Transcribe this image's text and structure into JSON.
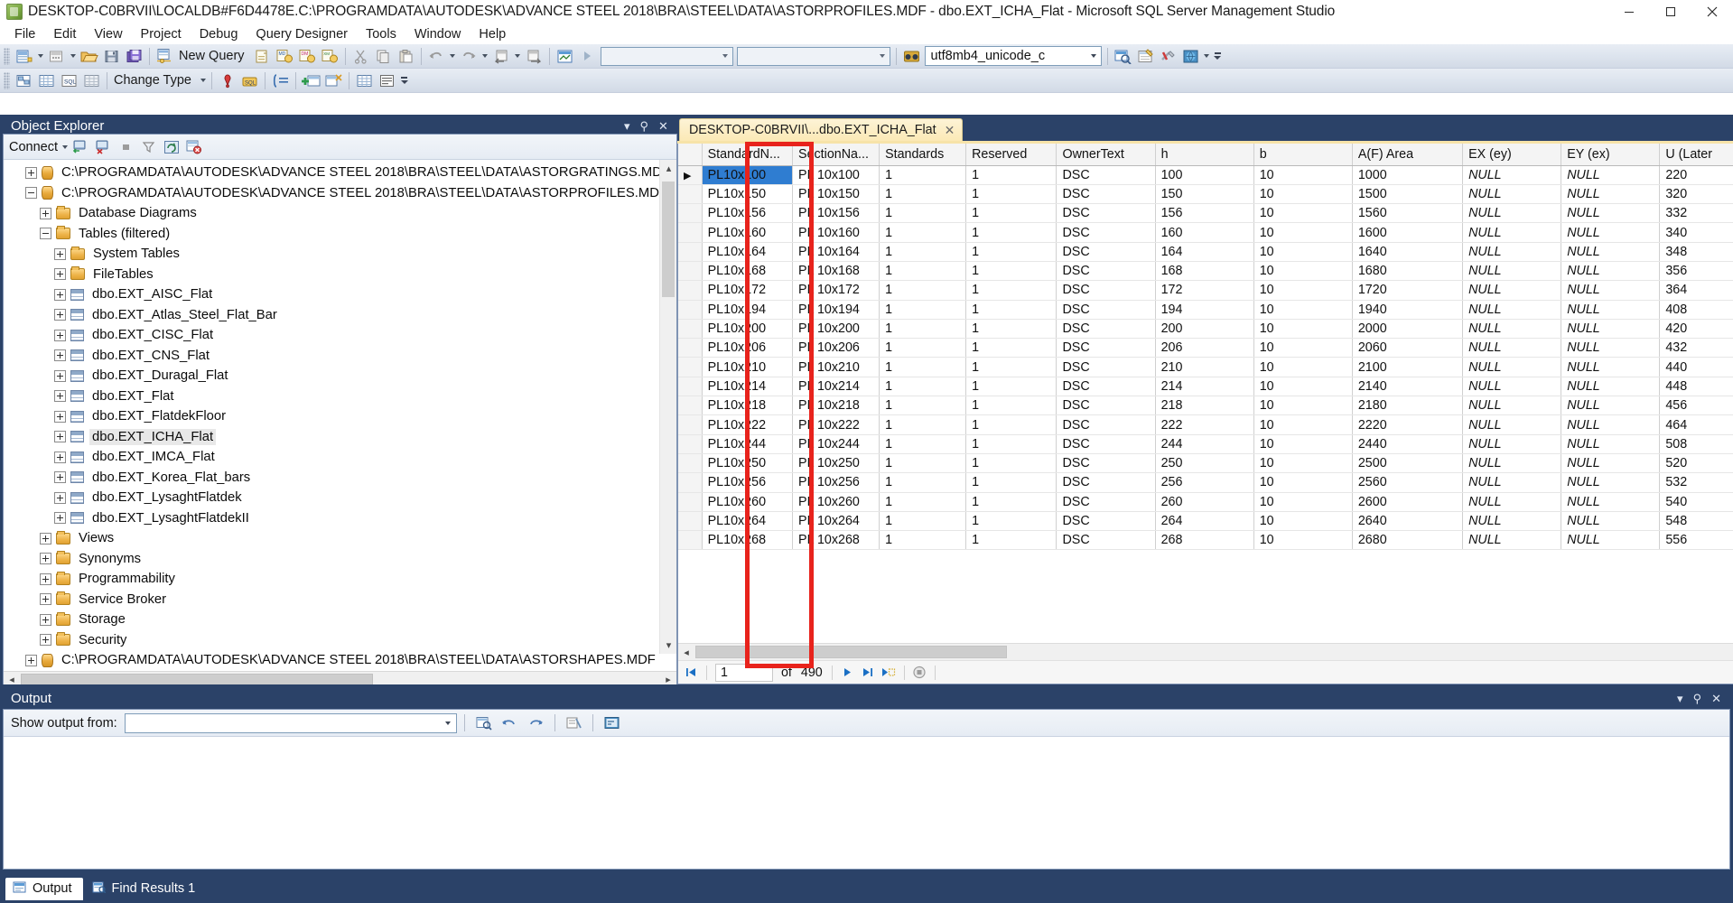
{
  "window": {
    "title": "DESKTOP-C0BRVII\\LOCALDB#F6D4478E.C:\\PROGRAMDATA\\AUTODESK\\ADVANCE STEEL 2018\\BRA\\STEEL\\DATA\\ASTORPROFILES.MDF - dbo.EXT_ICHA_Flat - Microsoft SQL Server Management Studio",
    "app_icon": "ssms-icon",
    "minimize": "minimize-icon",
    "maximize": "maximize-icon",
    "close": "close-icon"
  },
  "menubar": {
    "items": [
      {
        "label": "File"
      },
      {
        "label": "Edit"
      },
      {
        "label": "View"
      },
      {
        "label": "Project"
      },
      {
        "label": "Debug"
      },
      {
        "label": "Query Designer"
      },
      {
        "label": "Tools"
      },
      {
        "label": "Window"
      },
      {
        "label": "Help"
      }
    ]
  },
  "toolbar1": {
    "new_query_label": "New Query",
    "collation_value": "utf8mb4_unicode_c",
    "server_dropdown_value": "",
    "database_dropdown_value": ""
  },
  "toolbar2": {
    "change_type_label": "Change Type"
  },
  "object_explorer": {
    "title": "Object Explorer",
    "connect_label": "Connect",
    "tree": [
      {
        "label": "C:\\PROGRAMDATA\\AUTODESK\\ADVANCE STEEL 2018\\BRA\\STEEL\\DATA\\ASTORGRATINGS.MDF",
        "indent": 1,
        "icon": "database-icon",
        "state": "plus"
      },
      {
        "label": "C:\\PROGRAMDATA\\AUTODESK\\ADVANCE STEEL 2018\\BRA\\STEEL\\DATA\\ASTORPROFILES.MDF",
        "indent": 1,
        "icon": "database-icon",
        "state": "minus"
      },
      {
        "label": "Database Diagrams",
        "indent": 2,
        "icon": "folder-icon",
        "state": "plus"
      },
      {
        "label": "Tables (filtered)",
        "indent": 2,
        "icon": "folder-icon",
        "state": "minus"
      },
      {
        "label": "System Tables",
        "indent": 3,
        "icon": "folder-icon",
        "state": "plus"
      },
      {
        "label": "FileTables",
        "indent": 3,
        "icon": "folder-icon",
        "state": "plus"
      },
      {
        "label": "dbo.EXT_AISC_Flat",
        "indent": 3,
        "icon": "table-icon",
        "state": "plus"
      },
      {
        "label": "dbo.EXT_Atlas_Steel_Flat_Bar",
        "indent": 3,
        "icon": "table-icon",
        "state": "plus"
      },
      {
        "label": "dbo.EXT_CISC_Flat",
        "indent": 3,
        "icon": "table-icon",
        "state": "plus"
      },
      {
        "label": "dbo.EXT_CNS_Flat",
        "indent": 3,
        "icon": "table-icon",
        "state": "plus"
      },
      {
        "label": "dbo.EXT_Duragal_Flat",
        "indent": 3,
        "icon": "table-icon",
        "state": "plus"
      },
      {
        "label": "dbo.EXT_Flat",
        "indent": 3,
        "icon": "table-icon",
        "state": "plus"
      },
      {
        "label": "dbo.EXT_FlatdekFloor",
        "indent": 3,
        "icon": "table-icon",
        "state": "plus"
      },
      {
        "label": "dbo.EXT_ICHA_Flat",
        "indent": 3,
        "icon": "table-icon",
        "state": "plus",
        "selected": true
      },
      {
        "label": "dbo.EXT_IMCA_Flat",
        "indent": 3,
        "icon": "table-icon",
        "state": "plus"
      },
      {
        "label": "dbo.EXT_Korea_Flat_bars",
        "indent": 3,
        "icon": "table-icon",
        "state": "plus"
      },
      {
        "label": "dbo.EXT_LysaghtFlatdek",
        "indent": 3,
        "icon": "table-icon",
        "state": "plus"
      },
      {
        "label": "dbo.EXT_LysaghtFlatdekII",
        "indent": 3,
        "icon": "table-icon",
        "state": "plus"
      },
      {
        "label": "Views",
        "indent": 2,
        "icon": "folder-icon",
        "state": "plus"
      },
      {
        "label": "Synonyms",
        "indent": 2,
        "icon": "folder-icon",
        "state": "plus"
      },
      {
        "label": "Programmability",
        "indent": 2,
        "icon": "folder-icon",
        "state": "plus"
      },
      {
        "label": "Service Broker",
        "indent": 2,
        "icon": "folder-icon",
        "state": "plus"
      },
      {
        "label": "Storage",
        "indent": 2,
        "icon": "folder-icon",
        "state": "plus"
      },
      {
        "label": "Security",
        "indent": 2,
        "icon": "folder-icon",
        "state": "plus"
      },
      {
        "label": "C:\\PROGRAMDATA\\AUTODESK\\ADVANCE STEEL 2018\\BRA\\STEEL\\DATA\\ASTORSHAPES.MDF",
        "indent": 1,
        "icon": "database-icon",
        "state": "plus"
      }
    ]
  },
  "document_tab": {
    "label": "DESKTOP-C0BRVII\\...dbo.EXT_ICHA_Flat",
    "close": "close-icon"
  },
  "grid": {
    "columns": [
      "StandardN...",
      "SectionNa...",
      "Standards",
      "Reserved",
      "OwnerText",
      "h",
      "b",
      "A(F) Area",
      "EX (ey)",
      "EY (ex)",
      "U (Later"
    ],
    "rows": [
      {
        "StandardName": "PL10x100",
        "SectionName": "PL 10x100",
        "Standards": "1",
        "Reserved": "1",
        "OwnerText": "DSC",
        "h": "100",
        "b": "10",
        "Area": "1000",
        "EX": "NULL",
        "EY": "NULL",
        "U": "220",
        "selected": true,
        "current": true
      },
      {
        "StandardName": "PL10x150",
        "SectionName": "PL 10x150",
        "Standards": "1",
        "Reserved": "1",
        "OwnerText": "DSC",
        "h": "150",
        "b": "10",
        "Area": "1500",
        "EX": "NULL",
        "EY": "NULL",
        "U": "320"
      },
      {
        "StandardName": "PL10x156",
        "SectionName": "PL 10x156",
        "Standards": "1",
        "Reserved": "1",
        "OwnerText": "DSC",
        "h": "156",
        "b": "10",
        "Area": "1560",
        "EX": "NULL",
        "EY": "NULL",
        "U": "332"
      },
      {
        "StandardName": "PL10x160",
        "SectionName": "PL 10x160",
        "Standards": "1",
        "Reserved": "1",
        "OwnerText": "DSC",
        "h": "160",
        "b": "10",
        "Area": "1600",
        "EX": "NULL",
        "EY": "NULL",
        "U": "340"
      },
      {
        "StandardName": "PL10x164",
        "SectionName": "PL 10x164",
        "Standards": "1",
        "Reserved": "1",
        "OwnerText": "DSC",
        "h": "164",
        "b": "10",
        "Area": "1640",
        "EX": "NULL",
        "EY": "NULL",
        "U": "348"
      },
      {
        "StandardName": "PL10x168",
        "SectionName": "PL 10x168",
        "Standards": "1",
        "Reserved": "1",
        "OwnerText": "DSC",
        "h": "168",
        "b": "10",
        "Area": "1680",
        "EX": "NULL",
        "EY": "NULL",
        "U": "356"
      },
      {
        "StandardName": "PL10x172",
        "SectionName": "PL 10x172",
        "Standards": "1",
        "Reserved": "1",
        "OwnerText": "DSC",
        "h": "172",
        "b": "10",
        "Area": "1720",
        "EX": "NULL",
        "EY": "NULL",
        "U": "364"
      },
      {
        "StandardName": "PL10x194",
        "SectionName": "PL 10x194",
        "Standards": "1",
        "Reserved": "1",
        "OwnerText": "DSC",
        "h": "194",
        "b": "10",
        "Area": "1940",
        "EX": "NULL",
        "EY": "NULL",
        "U": "408"
      },
      {
        "StandardName": "PL10x200",
        "SectionName": "PL 10x200",
        "Standards": "1",
        "Reserved": "1",
        "OwnerText": "DSC",
        "h": "200",
        "b": "10",
        "Area": "2000",
        "EX": "NULL",
        "EY": "NULL",
        "U": "420"
      },
      {
        "StandardName": "PL10x206",
        "SectionName": "PL 10x206",
        "Standards": "1",
        "Reserved": "1",
        "OwnerText": "DSC",
        "h": "206",
        "b": "10",
        "Area": "2060",
        "EX": "NULL",
        "EY": "NULL",
        "U": "432"
      },
      {
        "StandardName": "PL10x210",
        "SectionName": "PL 10x210",
        "Standards": "1",
        "Reserved": "1",
        "OwnerText": "DSC",
        "h": "210",
        "b": "10",
        "Area": "2100",
        "EX": "NULL",
        "EY": "NULL",
        "U": "440"
      },
      {
        "StandardName": "PL10x214",
        "SectionName": "PL 10x214",
        "Standards": "1",
        "Reserved": "1",
        "OwnerText": "DSC",
        "h": "214",
        "b": "10",
        "Area": "2140",
        "EX": "NULL",
        "EY": "NULL",
        "U": "448"
      },
      {
        "StandardName": "PL10x218",
        "SectionName": "PL 10x218",
        "Standards": "1",
        "Reserved": "1",
        "OwnerText": "DSC",
        "h": "218",
        "b": "10",
        "Area": "2180",
        "EX": "NULL",
        "EY": "NULL",
        "U": "456"
      },
      {
        "StandardName": "PL10x222",
        "SectionName": "PL 10x222",
        "Standards": "1",
        "Reserved": "1",
        "OwnerText": "DSC",
        "h": "222",
        "b": "10",
        "Area": "2220",
        "EX": "NULL",
        "EY": "NULL",
        "U": "464"
      },
      {
        "StandardName": "PL10x244",
        "SectionName": "PL 10x244",
        "Standards": "1",
        "Reserved": "1",
        "OwnerText": "DSC",
        "h": "244",
        "b": "10",
        "Area": "2440",
        "EX": "NULL",
        "EY": "NULL",
        "U": "508"
      },
      {
        "StandardName": "PL10x250",
        "SectionName": "PL 10x250",
        "Standards": "1",
        "Reserved": "1",
        "OwnerText": "DSC",
        "h": "250",
        "b": "10",
        "Area": "2500",
        "EX": "NULL",
        "EY": "NULL",
        "U": "520"
      },
      {
        "StandardName": "PL10x256",
        "SectionName": "PL 10x256",
        "Standards": "1",
        "Reserved": "1",
        "OwnerText": "DSC",
        "h": "256",
        "b": "10",
        "Area": "2560",
        "EX": "NULL",
        "EY": "NULL",
        "U": "532"
      },
      {
        "StandardName": "PL10x260",
        "SectionName": "PL 10x260",
        "Standards": "1",
        "Reserved": "1",
        "OwnerText": "DSC",
        "h": "260",
        "b": "10",
        "Area": "2600",
        "EX": "NULL",
        "EY": "NULL",
        "U": "540"
      },
      {
        "StandardName": "PL10x264",
        "SectionName": "PL 10x264",
        "Standards": "1",
        "Reserved": "1",
        "OwnerText": "DSC",
        "h": "264",
        "b": "10",
        "Area": "2640",
        "EX": "NULL",
        "EY": "NULL",
        "U": "548"
      },
      {
        "StandardName": "PL10x268",
        "SectionName": "PL 10x268",
        "Standards": "1",
        "Reserved": "1",
        "OwnerText": "DSC",
        "h": "268",
        "b": "10",
        "Area": "2680",
        "EX": "NULL",
        "EY": "NULL",
        "U": "556"
      }
    ]
  },
  "navigator": {
    "current_row": "1",
    "of_label": "of",
    "total_rows": "490",
    "first_icon": "first-record-icon",
    "prev_icon": "previous-record-icon",
    "next_icon": "next-record-icon",
    "last_icon": "last-record-icon",
    "new_icon": "new-record-icon",
    "stop_icon": "stop-icon"
  },
  "output": {
    "title": "Output",
    "show_output_from_label": "Show output from:",
    "show_output_from_value": ""
  },
  "statusbar": {
    "tabs": [
      {
        "label": "Output",
        "icon": "output-icon",
        "active": true
      },
      {
        "label": "Find Results 1",
        "icon": "find-results-icon",
        "active": false
      }
    ]
  },
  "annotation": {
    "color": "#e8231c",
    "target": "StandardName column highlight"
  }
}
